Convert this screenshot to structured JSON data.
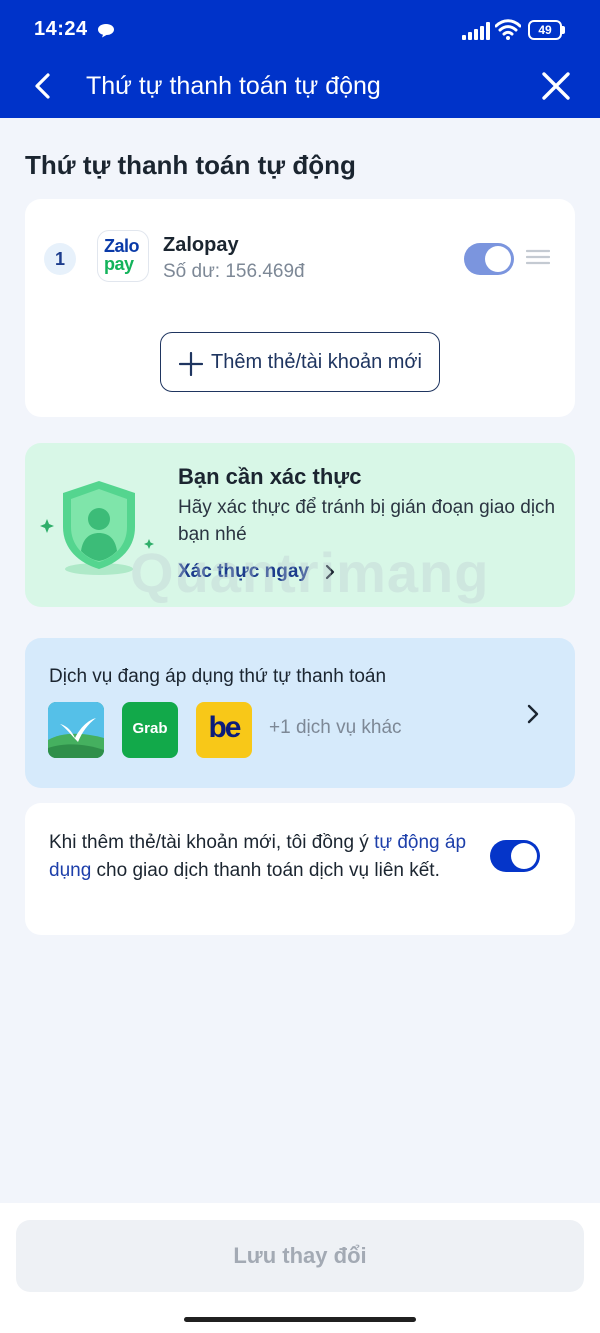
{
  "status_bar": {
    "time": "14:24",
    "battery": "49"
  },
  "nav": {
    "title": "Thứ tự thanh toán tự động"
  },
  "section_title": "Thứ tự thanh toán tự động",
  "payment_methods": [
    {
      "order": "1",
      "logo_top": "Zalo",
      "logo_bottom": "pay",
      "name": "Zalopay",
      "balance": "Số dư: 156.469đ",
      "enabled": true
    }
  ],
  "add_method_label": "Thêm thẻ/tài khoản mới",
  "verify": {
    "title": "Bạn cần xác thực",
    "description": "Hãy xác thực để tránh bị gián đoạn giao dịch bạn nhé",
    "link": "Xác thực ngay"
  },
  "watermark": "Quantrimang",
  "services": {
    "title": "Dịch vụ đang áp dụng thứ tự thanh toán",
    "items": [
      {
        "icon": "bird-app-icon"
      },
      {
        "icon": "grab-icon",
        "label": "Grab"
      },
      {
        "icon": "be-icon",
        "label": "be"
      }
    ],
    "more": "+1 dịch vụ khác"
  },
  "consent": {
    "text_before": "Khi thêm thẻ/tài khoản mới, tôi đồng ý ",
    "link": "tự động áp dụng",
    "text_after": " cho giao dịch thanh toán dịch vụ liên kết.",
    "enabled": true
  },
  "save_label": "Lưu thay đổi",
  "colors": {
    "header": "#0033c9",
    "toggle_on": "#0535c9",
    "toggle_dim": "#7b95de",
    "verify_bg": "#d8f7e7",
    "services_bg": "#d6eafb"
  }
}
